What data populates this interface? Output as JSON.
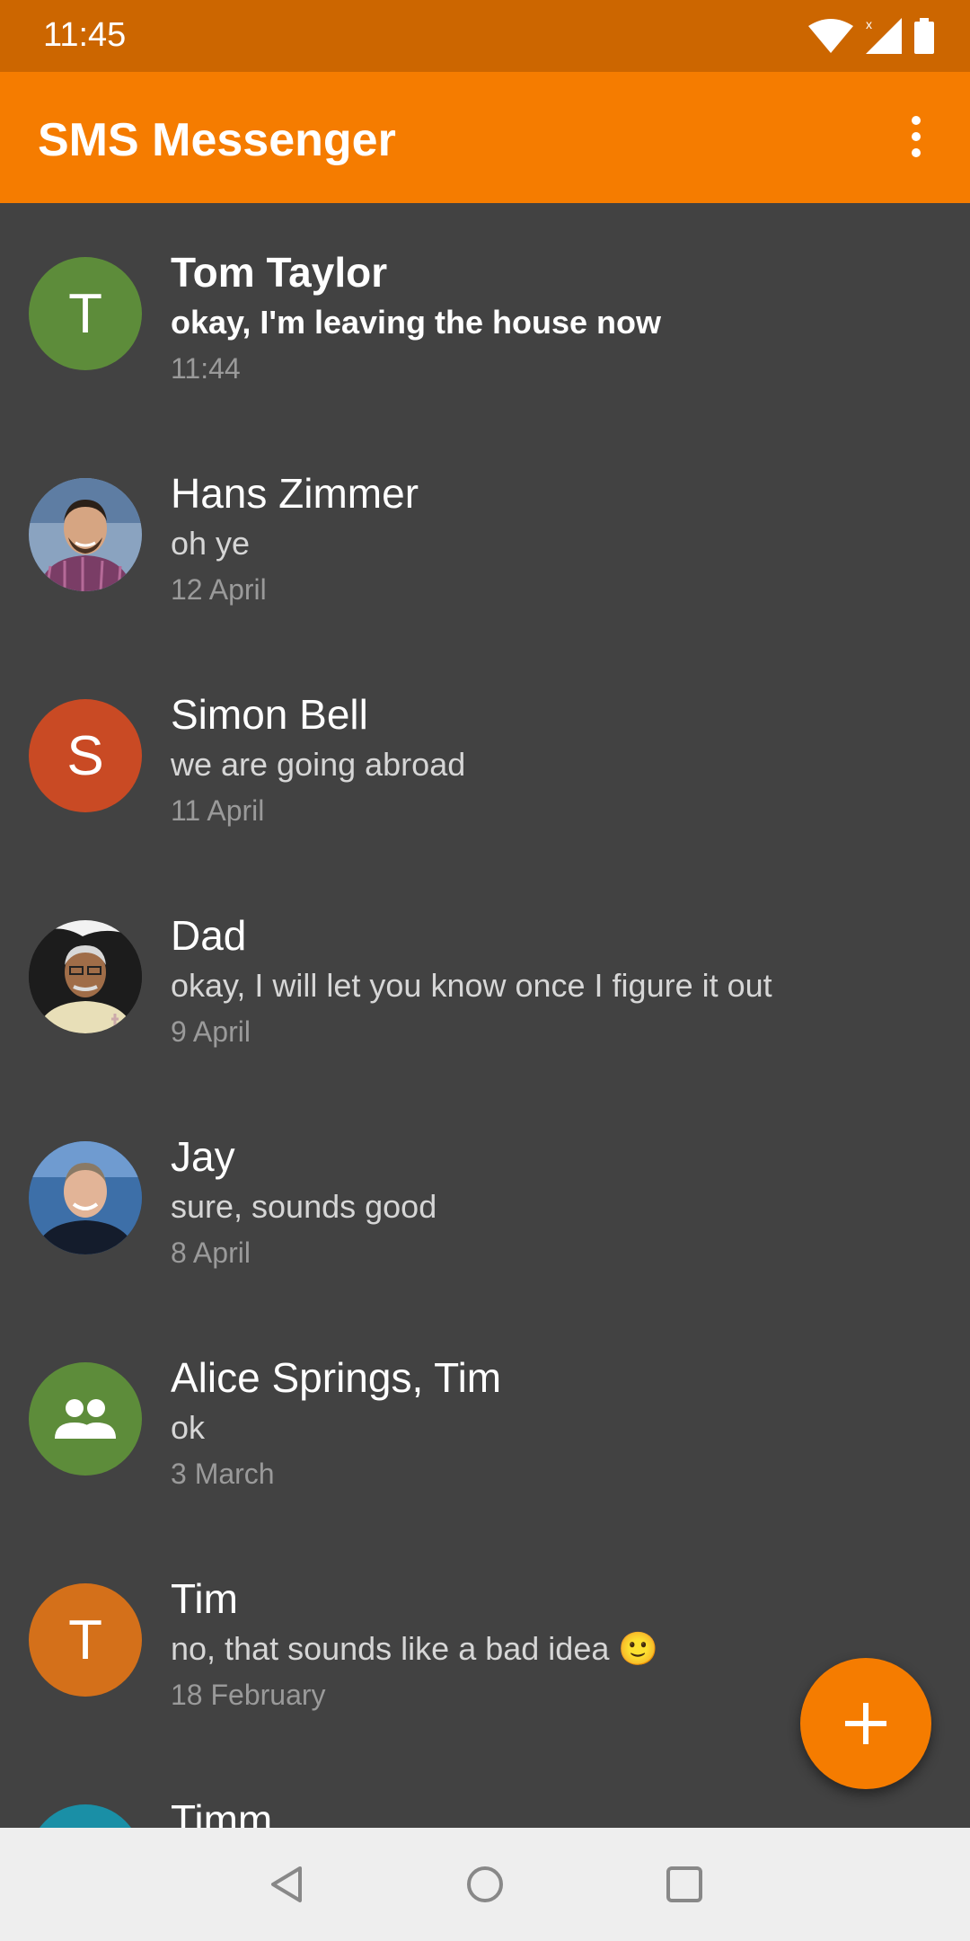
{
  "status_bar": {
    "time": "11:45",
    "icons": [
      "wifi-icon",
      "signal-icon",
      "battery-icon"
    ]
  },
  "app_bar": {
    "title": "SMS Messenger",
    "menu_icon": "more-vert-icon"
  },
  "conversations": [
    {
      "name": "Tom Taylor",
      "snippet": "okay, I'm leaving the house now",
      "date": "11:44",
      "avatar_letter": "T",
      "avatar_color": "#5d8c3a",
      "unread": true
    },
    {
      "name": "Hans Zimmer",
      "snippet": "oh ye",
      "date": "12 April",
      "avatar_type": "photo"
    },
    {
      "name": "Simon Bell",
      "snippet": "we are going abroad",
      "date": "11 April",
      "avatar_letter": "S",
      "avatar_color": "#c94a24"
    },
    {
      "name": "Dad",
      "snippet": "okay, I will let you know once I figure it out",
      "date": "9 April",
      "avatar_type": "photo"
    },
    {
      "name": "Jay",
      "snippet": "sure, sounds good",
      "date": "8 April",
      "avatar_type": "photo"
    },
    {
      "name": "Alice Springs, Tim",
      "snippet": "ok",
      "date": "3 March",
      "avatar_type": "group-icon",
      "avatar_color": "#5d8c3a"
    },
    {
      "name": "Tim",
      "snippet": "no, that sounds like a bad idea 🙂",
      "date": "18 February",
      "avatar_letter": "T",
      "avatar_color": "#d4701a"
    },
    {
      "name": "Timm",
      "avatar_color": "#1a8fa6"
    }
  ],
  "fab": {
    "icon": "plus-icon",
    "color": "#f57c00"
  },
  "nav_bar": {
    "icons": [
      "back-triangle-icon",
      "home-circle-icon",
      "recents-square-icon"
    ]
  },
  "colors": {
    "app_bar": "#f57c00",
    "status_bar": "#cc6600",
    "background": "#424242"
  }
}
